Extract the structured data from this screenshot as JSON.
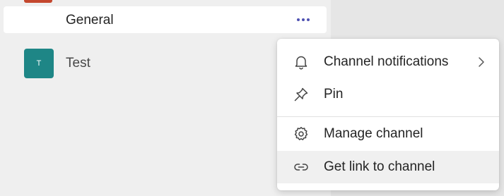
{
  "sidebar": {
    "channel": {
      "label": "General"
    },
    "team": {
      "avatar_initial": "T",
      "label": "Test",
      "avatar_color": "#1e8686"
    }
  },
  "context_menu": {
    "items": [
      {
        "label": "Channel notifications",
        "icon": "bell-icon",
        "has_submenu": true
      },
      {
        "label": "Pin",
        "icon": "pin-icon"
      },
      {
        "label": "Manage channel",
        "icon": "gear-icon"
      },
      {
        "label": "Get link to channel",
        "icon": "link-icon",
        "highlighted": true
      }
    ]
  },
  "colors": {
    "accent": "#4f52b2",
    "sidebar_bg": "#efefef",
    "menu_hover": "#f0f0f0"
  }
}
